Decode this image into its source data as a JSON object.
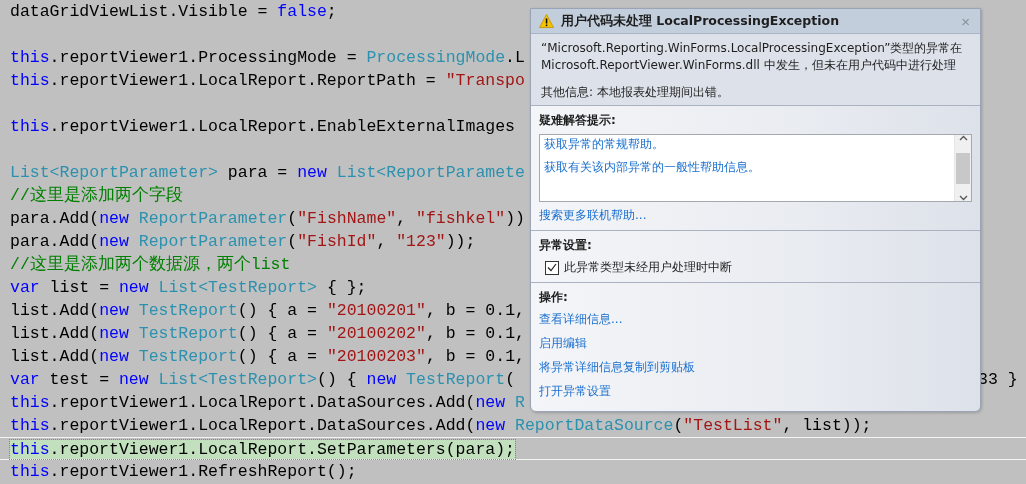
{
  "code_blocks": [
    [
      {
        "tokens": [
          {
            "kind": "plain",
            "text": "dataGridViewList.Visible = "
          },
          {
            "kind": "keyword",
            "text": "false"
          },
          {
            "kind": "plain",
            "text": ";"
          }
        ]
      }
    ],
    [
      {
        "tokens": [
          {
            "kind": "keyword",
            "text": "this"
          },
          {
            "kind": "plain",
            "text": ".reportViewer1.ProcessingMode = "
          },
          {
            "kind": "type",
            "text": "ProcessingMode"
          },
          {
            "kind": "plain",
            "text": ".L"
          }
        ]
      },
      {
        "tokens": [
          {
            "kind": "keyword",
            "text": "this"
          },
          {
            "kind": "plain",
            "text": ".reportViewer1.LocalReport.ReportPath = "
          },
          {
            "kind": "string",
            "text": "\"Transpo"
          }
        ]
      }
    ],
    [
      {
        "tokens": [
          {
            "kind": "keyword",
            "text": "this"
          },
          {
            "kind": "plain",
            "text": ".reportViewer1.LocalReport.EnableExternalImages"
          }
        ]
      }
    ],
    [
      {
        "tokens": [
          {
            "kind": "type",
            "text": "List<ReportParameter>"
          },
          {
            "kind": "plain",
            "text": " para = "
          },
          {
            "kind": "keyword",
            "text": "new "
          },
          {
            "kind": "type",
            "text": "List<ReportParamete"
          }
        ]
      },
      {
        "tokens": [
          {
            "kind": "comment",
            "text": "//这里是添加两个字段"
          }
        ]
      },
      {
        "tokens": [
          {
            "kind": "plain",
            "text": "para.Add("
          },
          {
            "kind": "keyword",
            "text": "new "
          },
          {
            "kind": "type",
            "text": "ReportParameter"
          },
          {
            "kind": "plain",
            "text": "("
          },
          {
            "kind": "string",
            "text": "\"FishName\""
          },
          {
            "kind": "plain",
            "text": ", "
          },
          {
            "kind": "string",
            "text": "\"fishkel\""
          },
          {
            "kind": "plain",
            "text": "))"
          }
        ]
      },
      {
        "tokens": [
          {
            "kind": "plain",
            "text": "para.Add("
          },
          {
            "kind": "keyword",
            "text": "new "
          },
          {
            "kind": "type",
            "text": "ReportParameter"
          },
          {
            "kind": "plain",
            "text": "("
          },
          {
            "kind": "string",
            "text": "\"FishId\""
          },
          {
            "kind": "plain",
            "text": ", "
          },
          {
            "kind": "string",
            "text": "\"123\""
          },
          {
            "kind": "plain",
            "text": "));"
          }
        ]
      },
      {
        "tokens": [
          {
            "kind": "comment",
            "text": "//这里是添加两个数据源，两个list"
          }
        ]
      },
      {
        "tokens": [
          {
            "kind": "keyword",
            "text": "var"
          },
          {
            "kind": "plain",
            "text": " list = "
          },
          {
            "kind": "keyword",
            "text": "new "
          },
          {
            "kind": "type",
            "text": "List<TestReport>"
          },
          {
            "kind": "plain",
            "text": " { };"
          }
        ]
      },
      {
        "tokens": [
          {
            "kind": "plain",
            "text": "list.Add("
          },
          {
            "kind": "keyword",
            "text": "new "
          },
          {
            "kind": "type",
            "text": "TestReport"
          },
          {
            "kind": "plain",
            "text": "() { a = "
          },
          {
            "kind": "string",
            "text": "\"20100201\""
          },
          {
            "kind": "plain",
            "text": ", b = 0.1,"
          }
        ]
      },
      {
        "tokens": [
          {
            "kind": "plain",
            "text": "list.Add("
          },
          {
            "kind": "keyword",
            "text": "new "
          },
          {
            "kind": "type",
            "text": "TestReport"
          },
          {
            "kind": "plain",
            "text": "() { a = "
          },
          {
            "kind": "string",
            "text": "\"20100202\""
          },
          {
            "kind": "plain",
            "text": ", b = 0.1,"
          }
        ]
      },
      {
        "tokens": [
          {
            "kind": "plain",
            "text": "list.Add("
          },
          {
            "kind": "keyword",
            "text": "new "
          },
          {
            "kind": "type",
            "text": "TestReport"
          },
          {
            "kind": "plain",
            "text": "() { a = "
          },
          {
            "kind": "string",
            "text": "\"20100203\""
          },
          {
            "kind": "plain",
            "text": ", b = 0.1,"
          }
        ]
      },
      {
        "tokens": [
          {
            "kind": "keyword",
            "text": "var"
          },
          {
            "kind": "plain",
            "text": " test = "
          },
          {
            "kind": "keyword",
            "text": "new "
          },
          {
            "kind": "type",
            "text": "List<TestReport>"
          },
          {
            "kind": "plain",
            "text": "() { "
          },
          {
            "kind": "keyword",
            "text": "new "
          },
          {
            "kind": "type",
            "text": "TestReport"
          },
          {
            "kind": "plain",
            "text": "("
          }
        ],
        "tail": "33 }"
      },
      {
        "tokens": [
          {
            "kind": "keyword",
            "text": "this"
          },
          {
            "kind": "plain",
            "text": ".reportViewer1.LocalReport.DataSources.Add("
          },
          {
            "kind": "keyword",
            "text": "new "
          },
          {
            "kind": "type",
            "text": "R"
          }
        ]
      },
      {
        "tokens": [
          {
            "kind": "keyword",
            "text": "this"
          },
          {
            "kind": "plain",
            "text": ".reportViewer1.LocalReport.DataSources.Add("
          },
          {
            "kind": "keyword",
            "text": "new "
          },
          {
            "kind": "type",
            "text": "ReportDataSource"
          },
          {
            "kind": "plain",
            "text": "("
          },
          {
            "kind": "string",
            "text": "\"TestList\""
          },
          {
            "kind": "plain",
            "text": ", list));"
          }
        ]
      },
      {
        "tokens": [
          {
            "kind": "keyword",
            "text": "this"
          },
          {
            "kind": "plain",
            "text": ".reportViewer1.LocalReport.SetParameters(para);"
          }
        ],
        "highlighted": true
      },
      {
        "tokens": [
          {
            "kind": "keyword",
            "text": "this"
          },
          {
            "kind": "plain",
            "text": ".reportViewer1.RefreshReport();"
          }
        ]
      }
    ]
  ],
  "exception_dialog": {
    "title": "用户代码未处理 LocalProcessingException",
    "close": "×",
    "message": "“Microsoft.Reporting.WinForms.LocalProcessingException”类型的异常在 Microsoft.ReportViewer.WinForms.dll 中发生，但未在用户代码中进行处理",
    "additional_info": "其他信息: 本地报表处理期间出错。",
    "troubleshooting": {
      "heading": "疑难解答提示:",
      "tips": [
        "获取异常的常规帮助。",
        "获取有关该内部异常的一般性帮助信息。"
      ],
      "search_link": "搜索更多联机帮助..."
    },
    "settings": {
      "heading": "异常设置:",
      "checkbox": {
        "label": "此异常类型未经用户处理时中断",
        "checked": true
      }
    },
    "actions": {
      "heading": "操作:",
      "links": [
        "查看详细信息...",
        "启用编辑",
        "将异常详细信息复制到剪贴板",
        "打开异常设置"
      ]
    }
  }
}
